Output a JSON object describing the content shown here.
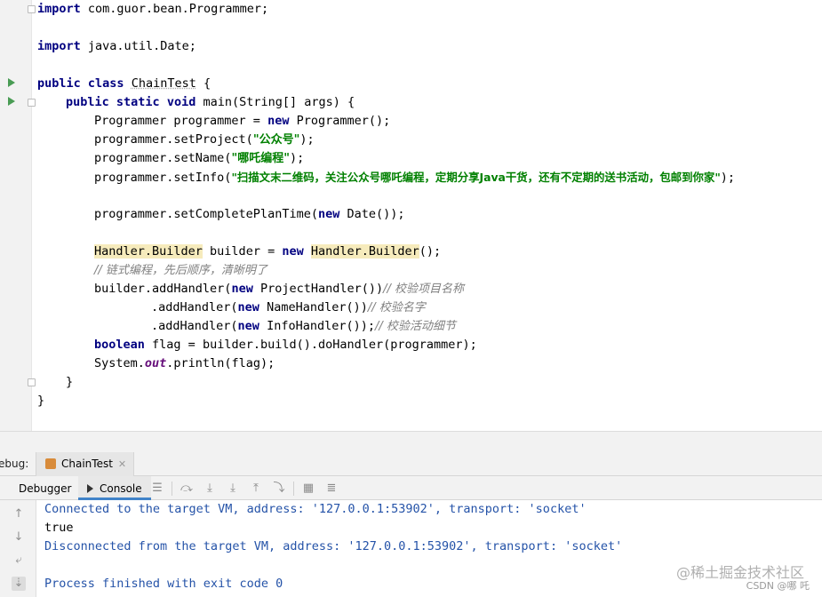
{
  "editor": {
    "import1": "com.guor.bean.Programmer;",
    "import2": "java.util.Date;",
    "kw_import": "import",
    "kw_public": "public",
    "kw_class": "class",
    "kw_static": "static",
    "kw_void": "void",
    "kw_new": "new",
    "kw_boolean": "boolean",
    "class_name": "ChainTest",
    "main_sig": "main(String[] args) {",
    "open_brace": "{",
    "close_brace": "}",
    "l1_a": "Programmer programmer = ",
    "l1_b": "Programmer();",
    "l2_a": "programmer.setProject(",
    "l2_str": "\"公众号\"",
    "l2_b": ");",
    "l3_a": "programmer.setName(",
    "l3_str": "\"哪吒编程\"",
    "l3_b": ");",
    "l4_a": "programmer.setInfo(",
    "l4_str": "\"扫描文末二维码，关注公众号哪吒编程，定期分享Java干货，还有不定期的送书活动，包邮到你家\"",
    "l4_b": ");",
    "l5_a": "programmer.setCompletePlanTime(",
    "l5_b": "Date());",
    "l6_hl1": "Handler.Builder",
    "l6_a": " builder = ",
    "l6_hl2": "Handler.Builder",
    "l6_b": "();",
    "l7_cmt": "// 链式编程，先后顺序，清晰明了",
    "l8_a": "builder.addHandler(",
    "l8_b": "ProjectHandler())",
    "l8_cmt": "// 校验项目名称",
    "l9_a": ".addHandler(",
    "l9_b": "NameHandler())",
    "l9_cmt": "// 校验名字",
    "l10_a": ".addHandler(",
    "l10_b": "InfoHandler());",
    "l10_cmt": "// 校验活动细节",
    "l11_b": "flag = builder.build().doHandler(programmer);",
    "l12_a": "System.",
    "l12_fld": "out",
    "l12_b": ".println(flag);"
  },
  "debug": {
    "label": "ebug:",
    "session_tab": "ChainTest",
    "session_close": "✕",
    "tab_debugger": "Debugger",
    "tab_console": "Console"
  },
  "console": {
    "line1": "Connected to the target VM, address: '127.0.0.1:53902', transport: 'socket'",
    "line2": "true",
    "line3": "Disconnected from the target VM, address: '127.0.0.1:53902', transport: 'socket'",
    "line4": "Process finished with exit code 0"
  },
  "watermark": {
    "site": "@稀土掘金技术社区",
    "author": "CSDN @哪 吒"
  }
}
